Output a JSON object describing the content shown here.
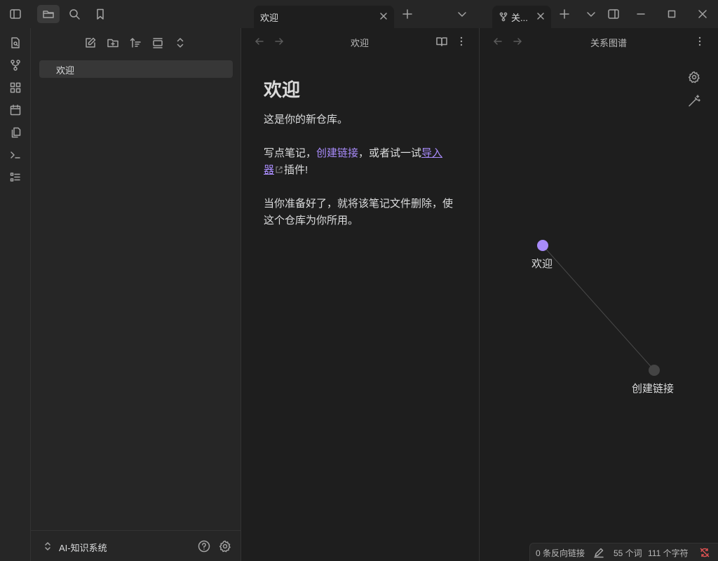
{
  "tabs": {
    "editor_tab": "欢迎",
    "graph_tab": "关..."
  },
  "explorer": {
    "files": [
      "欢迎"
    ],
    "vault_name": "AI-知识系统"
  },
  "editor": {
    "view_title": "欢迎",
    "heading": "欢迎",
    "p1": "这是你的新仓库。",
    "p2_before": "写点笔记，",
    "p2_link": "创建链接",
    "p2_mid": "，或者试一试",
    "p2_ext_link": "导入器",
    "p2_after": "插件!",
    "p3": "当你准备好了，就将该笔记文件删除，使这个仓库为你所用。"
  },
  "graph": {
    "view_title": "关系图谱",
    "nodes": [
      "欢迎",
      "创建链接"
    ],
    "colors": {
      "active_node": "#a88bfa",
      "unresolved_node": "#444444",
      "edge": "#4a4a4a"
    }
  },
  "status": {
    "backlinks": "0 条反向链接",
    "words": "55 个词",
    "chars": "111 个字符"
  }
}
